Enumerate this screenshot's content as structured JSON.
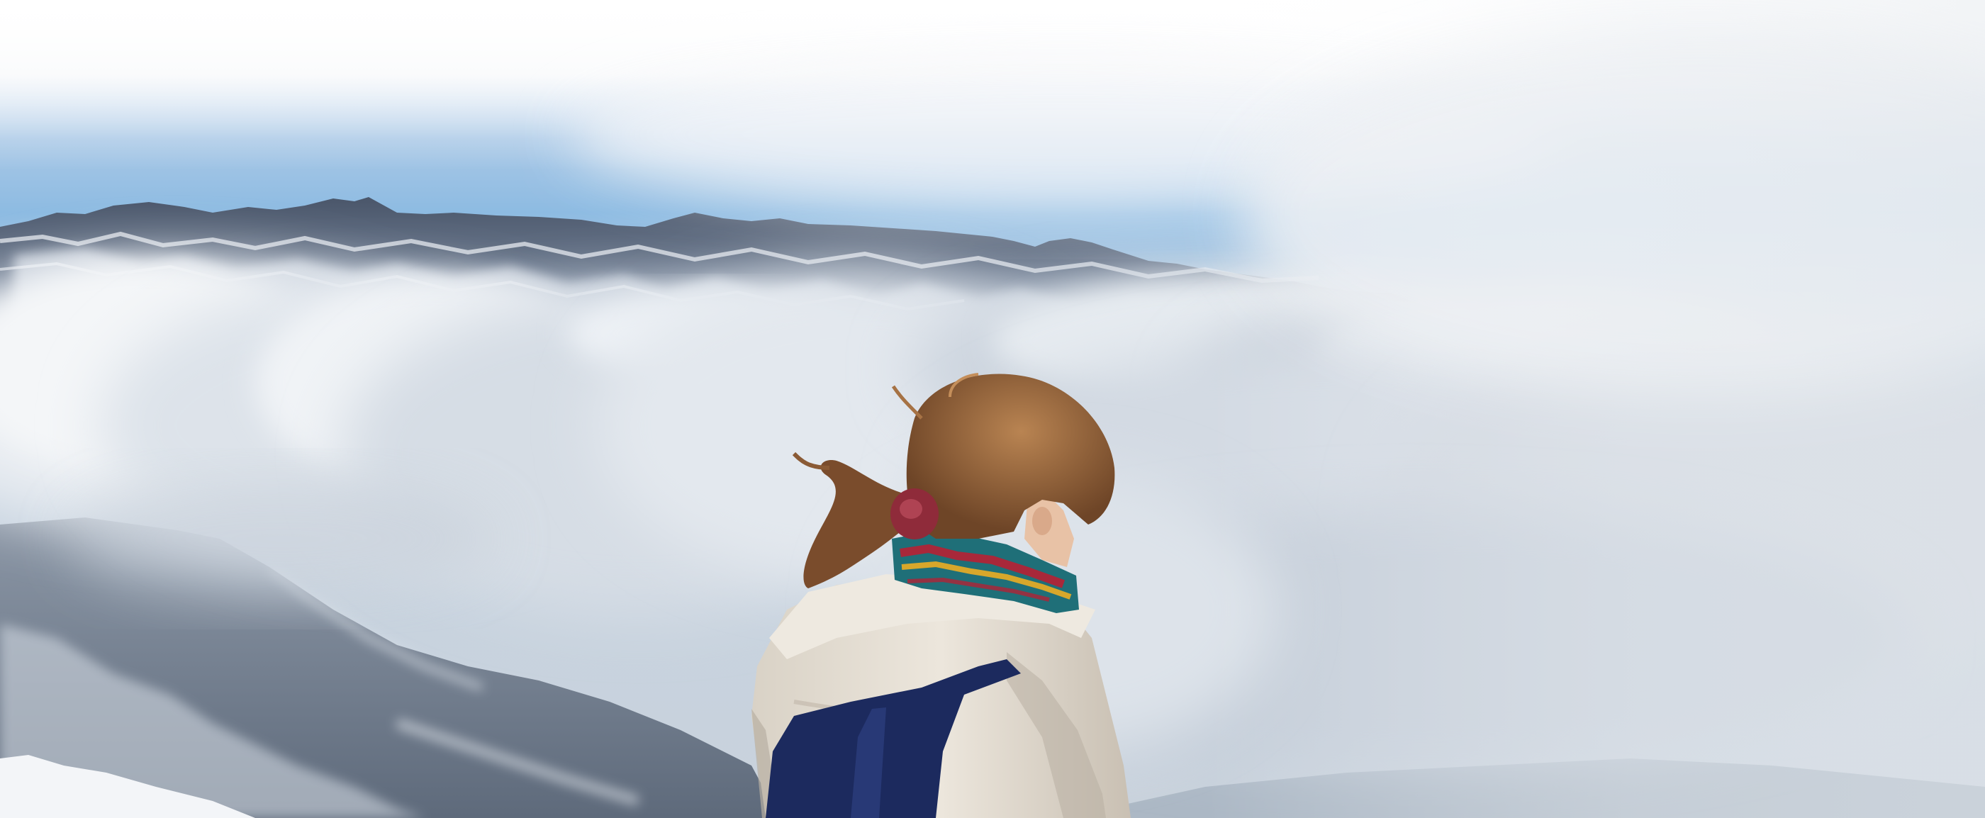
{
  "scene": {
    "description_visible_text": "",
    "palette": {
      "sky_top": "#fdfdfd",
      "sky_blue": "#a9c8e6",
      "sky_blue_deep": "#7fb0dc",
      "mountain_dark": "#3e4a5e",
      "mountain_mid": "#67768c",
      "snow": "#e9eef5",
      "cloud_light": "#f2f4f7",
      "cloud_mid": "#d3dae3",
      "cloud_shadow": "#aeb8c5",
      "lower_slope": "#7a8697",
      "hair": "#8a5a35",
      "hair_light": "#b98452",
      "jacket": "#e3dcd1",
      "jacket_shadow": "#b8afa2",
      "backpack": "#1c2a5e",
      "scarf_teal": "#1f6f78",
      "scarf_red": "#a8283a",
      "scarf_yellow": "#d7a72b",
      "skin": "#e8c2a6"
    }
  }
}
